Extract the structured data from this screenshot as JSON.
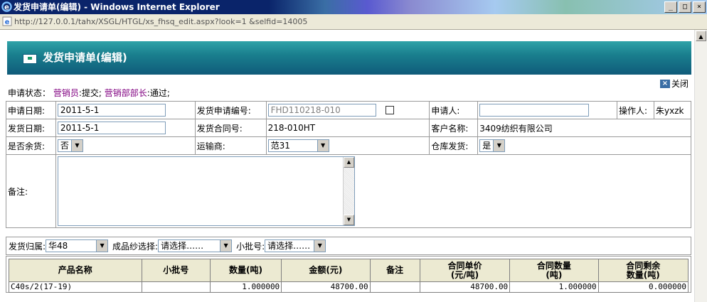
{
  "window": {
    "title": "发货申请单(编辑) - Windows Internet Explorer",
    "minimize": "_",
    "restore": "□",
    "close": "×"
  },
  "address": {
    "url": "http://127.0.0.1/tahx/XSGL/HTGL/xs_fhsq_edit.aspx?look=1 &selfid=14005"
  },
  "page": {
    "title": "发货申请单(编辑)",
    "close_label": "关闭"
  },
  "status": {
    "label": "申请状态：",
    "role1": "营销员",
    "action1": ":提交;",
    "role2": "营销部部长",
    "action2": ":通过;"
  },
  "form": {
    "apply_date_label": "申请日期:",
    "apply_date": "2011-5-1",
    "apply_no_label": "发货申请编号:",
    "apply_no": "FHD110218-010",
    "applicant_label": "申请人:",
    "applicant": "",
    "operator_label": "操作人:",
    "operator": "朱yxzk",
    "ship_date_label": "发货日期:",
    "ship_date": "2011-5-1",
    "contract_no_label": "发货合同号:",
    "contract_no": "218-010HT",
    "customer_label": "客户名称:",
    "customer": "3409纺织有限公司",
    "surplus_label": "是否余货:",
    "surplus": "否",
    "carrier_label": "运输商:",
    "carrier": "范31",
    "warehouse_label": "仓库发货:",
    "warehouse": "是",
    "remark_label": "备注:",
    "remark": ""
  },
  "filters": {
    "belong_label": "发货归属:",
    "belong": "华48",
    "yarn_label": "成品纱选择:",
    "yarn": "请选择……",
    "batch_label": "小批号:",
    "batch": "请选择……"
  },
  "grid": {
    "headers": [
      "产品名称",
      "小批号",
      "数量(吨)",
      "金额(元)",
      "备注",
      "合同单价\n(元/吨)",
      "合同数量\n(吨)",
      "合同剩余\n数量(吨)"
    ],
    "rows": [
      [
        "C40s/2(17-19)",
        "",
        "1.000000",
        "48700.00",
        "",
        "48700.00",
        "1.000000",
        "0.000000"
      ]
    ]
  }
}
